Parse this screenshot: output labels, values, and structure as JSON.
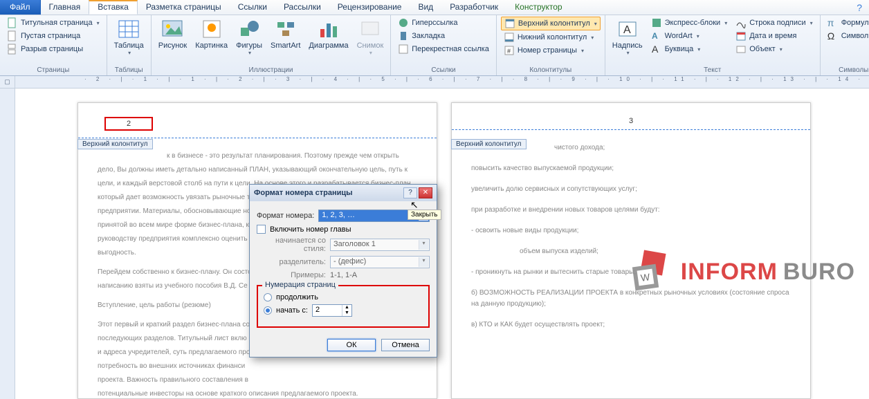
{
  "menubar": {
    "file": "Файл",
    "tabs": [
      "Главная",
      "Вставка",
      "Разметка страницы",
      "Ссылки",
      "Рассылки",
      "Рецензирование",
      "Вид",
      "Разработчик"
    ],
    "designer": "Конструктор",
    "active_index": 1
  },
  "ribbon": {
    "pages": {
      "label": "Страницы",
      "items": [
        "Титульная страница",
        "Пустая страница",
        "Разрыв страницы"
      ]
    },
    "tables": {
      "label": "Таблицы",
      "btn": "Таблица"
    },
    "illustrations": {
      "label": "Иллюстрации",
      "items": [
        "Рисунок",
        "Картинка",
        "Фигуры",
        "SmartArt",
        "Диаграмма",
        "Снимок"
      ]
    },
    "links": {
      "label": "Ссылки",
      "items": [
        "Гиперссылка",
        "Закладка",
        "Перекрестная ссылка"
      ]
    },
    "headers": {
      "label": "Колонтитулы",
      "items": [
        "Верхний колонтитул",
        "Нижний колонтитул",
        "Номер страницы"
      ]
    },
    "text": {
      "label": "Текст",
      "big": "Надпись",
      "items": [
        "Экспресс-блоки",
        "WordArt",
        "Буквица",
        "Строка подписи",
        "Дата и время",
        "Объект"
      ]
    },
    "symbols": {
      "label": "Символы",
      "items": [
        "Формула",
        "Символ"
      ]
    }
  },
  "ruler_text": "· 2 · | · 1 · | · 1 · | · 2 · | · 3 · | · 4 · | · 5 · | · 6 · | · 7 · | · 8 · | · 9 · | · 10 · | · 11 · | · 12 · | · 13 · | · 14 · | · 15 · | · 16 · | · 17 · | · 18 · | · 19 ·",
  "doc": {
    "header_tag": "Верхний колонтитул",
    "page2_num": "2",
    "page3_num": "3",
    "p2": [
      "к в бизнесе - это результат планирования. Поэтому прежде чем открыть",
      "дело, Вы должны иметь детально написанный ПЛАН, указывающий окончательную цель, путь к",
      "цели, и каждый верстовой столб на пути к цели. На основе этого и разрабатывается бизнес-план,",
      "который дает возможность увязать рыночные тенденции с перспективами развития",
      "предприятии. Материалы, обосновывающие но",
      "принятой во всем мире форме бизнес-плана, ко",
      "руководству предприятия комплексно оценить",
      "выгодность.",
      "Перейдем собственно к бизнес-плану. Он состо",
      "написанию взяты из учебного пособия В.Д. Сe",
      "Вступление, цель работы (резюме)",
      "Этот первый и краткий раздел бизнес-плана со",
      "последующих разделов. Титульный лист вклю",
      "и адреса учредителей, суть предлагаемого про",
      "потребность во внешних источниках финанси",
      "проекта. Важность правильного составления в",
      "потенциальные инвесторы на основе краткого описания предлагаемого проекта."
    ],
    "p3": [
      "чистого дохода;",
      "повысить качество выпускаемой продукции;",
      "увеличить долю сервисных и сопутствующих услуг;",
      "при разработке и внедрении новых товаров целями будут:",
      "- освоить новые виды продукции;",
      "объем выпуска изделий;",
      "- проникнуть на рынки и вытеснить старые товары;",
      "б) ВОЗМОЖНОСТЬ РЕАЛИЗАЦИИ ПРОЕКТА в конкретных рыночных условиях (состояние спроса на данную продукцию);",
      "в) КТО и КАК будет осуществлять проект;"
    ]
  },
  "watermark": {
    "a": "INFORM",
    "b": "BURO"
  },
  "dialog": {
    "title": "Формат номера страницы",
    "tooltip": "Закрыть",
    "format_label": "Формат номера:",
    "format_value": "1, 2, 3, …",
    "include_chapter": "Включить номер главы",
    "starts_style_label": "начинается со стиля:",
    "starts_style_value": "Заголовок 1",
    "sep_label": "разделитель:",
    "sep_value": "-   (дефис)",
    "examples_label": "Примеры:",
    "examples_value": "1-1, 1-A",
    "numbering_legend": "Нумерация страниц",
    "radio_continue": "продолжить",
    "radio_start": "начать с:",
    "start_value": "2",
    "ok": "ОК",
    "cancel": "Отмена"
  }
}
